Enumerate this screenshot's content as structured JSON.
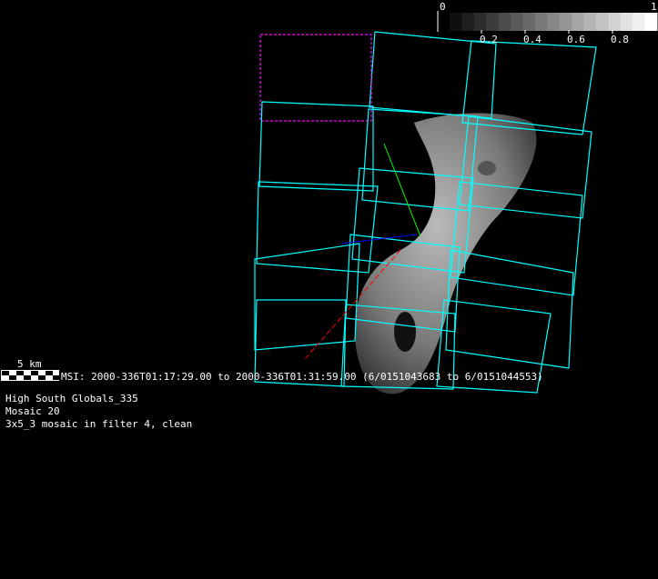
{
  "colorbar": {
    "min_label": "0",
    "max_label": "1",
    "ticks": [
      "0.2",
      "0.4",
      "0.6",
      "0.8"
    ],
    "steps": 17,
    "colormap": "grayscale"
  },
  "scale_bar": {
    "label": "5 km"
  },
  "msi_line": "MSI:  2000-336T01:17:29.00 to 2000-336T01:31:59.00 (6/0151043683 to 6/0151044553)",
  "info": [
    "High South Globals_335",
    "Mosaic 20",
    "3x5_3 mosaic in filter 4, clean"
  ],
  "colors": {
    "footprint": "#00ffff",
    "highlight": "#ff00ff",
    "axis_x": "#ff0000",
    "axis_y": "#00ff00",
    "axis_z": "#0000ff"
  }
}
